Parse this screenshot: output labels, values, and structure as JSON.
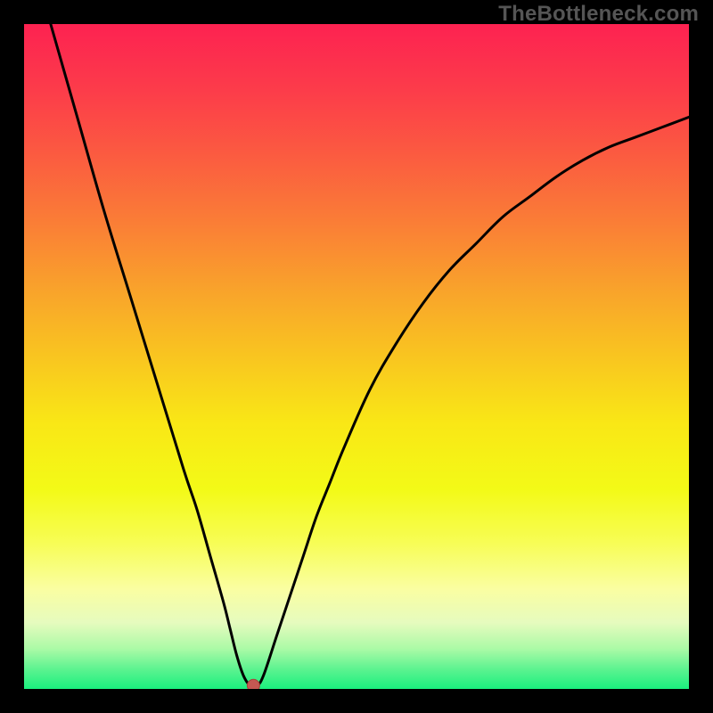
{
  "watermark": "TheBottleneck.com",
  "colors": {
    "background": "#000000",
    "curve": "#000000",
    "dot_fill": "#c55852",
    "dot_stroke": "#a83f39",
    "gradient_top": "#fd2251",
    "gradient_bottom": "#1aef7e"
  },
  "chart_data": {
    "type": "line",
    "title": "",
    "xlabel": "",
    "ylabel": "",
    "xlim": [
      0,
      100
    ],
    "ylim": [
      0,
      100
    ],
    "grid": false,
    "legend": false,
    "series": [
      {
        "name": "bottleneck-curve",
        "x": [
          4,
          8,
          12,
          16,
          20,
          24,
          26,
          28,
          30,
          31,
          32,
          33,
          34,
          35,
          36,
          38,
          40,
          42,
          44,
          46,
          48,
          52,
          56,
          60,
          64,
          68,
          72,
          76,
          80,
          84,
          88,
          92,
          96,
          100
        ],
        "y": [
          100,
          86,
          72,
          59,
          46,
          33,
          27,
          20,
          13,
          9,
          5,
          2,
          0.5,
          0.5,
          2,
          8,
          14,
          20,
          26,
          31,
          36,
          45,
          52,
          58,
          63,
          67,
          71,
          74,
          77,
          79.5,
          81.5,
          83,
          84.5,
          86
        ]
      }
    ],
    "annotations": [
      {
        "name": "minimum-dot",
        "x": 34.5,
        "y": 0.5
      }
    ],
    "background_gradient": {
      "stops": [
        {
          "pct": 0,
          "color": "#fd2251"
        },
        {
          "pct": 10,
          "color": "#fc3c4a"
        },
        {
          "pct": 20,
          "color": "#fb5c40"
        },
        {
          "pct": 30,
          "color": "#fa7e36"
        },
        {
          "pct": 40,
          "color": "#f9a32b"
        },
        {
          "pct": 50,
          "color": "#f9c520"
        },
        {
          "pct": 60,
          "color": "#f9e716"
        },
        {
          "pct": 70,
          "color": "#f3fa17"
        },
        {
          "pct": 78,
          "color": "#f7fd55"
        },
        {
          "pct": 85,
          "color": "#fafea2"
        },
        {
          "pct": 90,
          "color": "#e6fbbe"
        },
        {
          "pct": 94,
          "color": "#aafaa6"
        },
        {
          "pct": 97,
          "color": "#5df390"
        },
        {
          "pct": 100,
          "color": "#1aef7e"
        }
      ]
    }
  }
}
